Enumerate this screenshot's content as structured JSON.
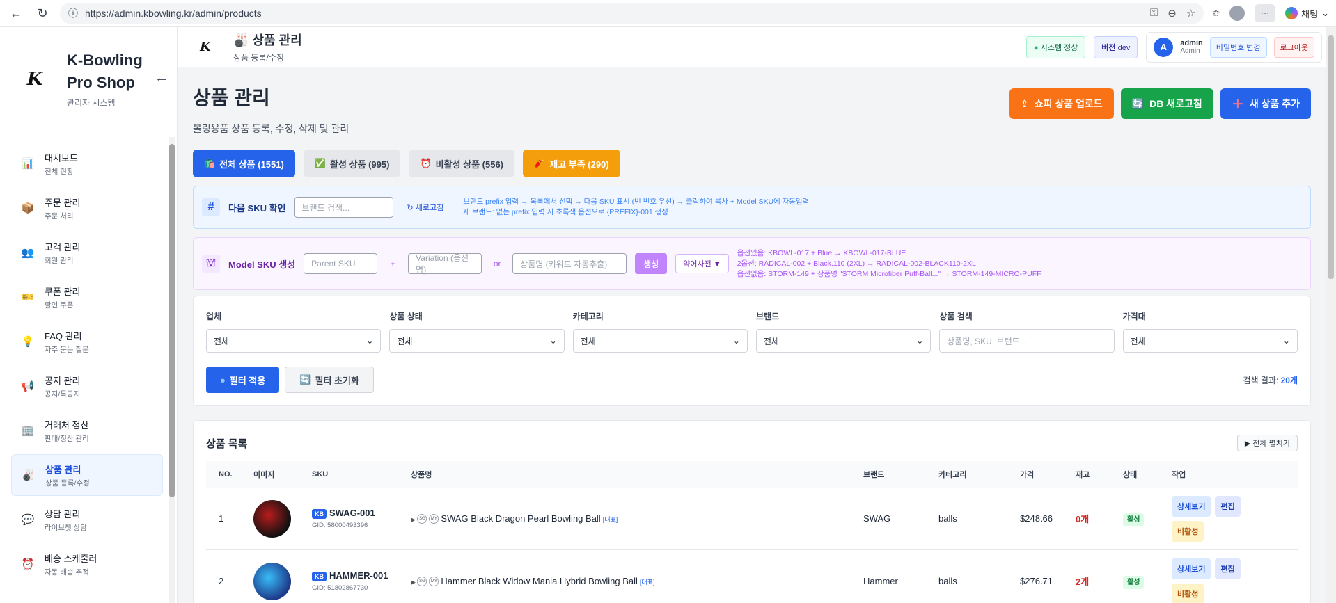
{
  "browser": {
    "url": "https://admin.kbowling.kr/admin/products",
    "chat_label": "채팅"
  },
  "sidebar": {
    "logo_text": "K",
    "title_line1": "K-Bowling",
    "title_line2": "Pro Shop",
    "subtitle": "관리자 시스템",
    "items": [
      {
        "title": "대시보드",
        "sub": "전체 현황",
        "icon": "📊"
      },
      {
        "title": "주문 관리",
        "sub": "주문 처리",
        "icon": "📦"
      },
      {
        "title": "고객 관리",
        "sub": "회원 관리",
        "icon": "👥"
      },
      {
        "title": "쿠폰 관리",
        "sub": "할인 쿠폰",
        "icon": "🎫"
      },
      {
        "title": "FAQ 관리",
        "sub": "자주 묻는 질문",
        "icon": "💡"
      },
      {
        "title": "공지 관리",
        "sub": "공지/특공지",
        "icon": "📢"
      },
      {
        "title": "거래처 정산",
        "sub": "판매/정산 관리",
        "icon": "🏢"
      },
      {
        "title": "상품 관리",
        "sub": "상품 등록/수정",
        "icon": "🎳"
      },
      {
        "title": "상담 관리",
        "sub": "라이브챗 상담",
        "icon": "💬"
      },
      {
        "title": "배송 스케줄러",
        "sub": "자동 배송 추적",
        "icon": "⏰"
      }
    ]
  },
  "topbar": {
    "title": "상품 관리",
    "subtitle": "상품 등록/수정",
    "system_status": "시스템 정상",
    "version_label": "버전",
    "version_value": "dev",
    "user_initial": "A",
    "user_name": "admin",
    "user_role": "Admin",
    "change_pw": "비밀번호 변경",
    "logout": "로그아웃"
  },
  "page": {
    "title": "상품 관리",
    "subtitle": "볼링용품 상품 등록, 수정, 삭제 및 관리",
    "btn_shopee": "쇼피 상품 업로드",
    "btn_db": "DB 새로고침",
    "btn_new": "새 상품 추가"
  },
  "tabs": {
    "all": "전체 상품 (1551)",
    "active": "활성 상품 (995)",
    "inactive": "비활성 상품 (556)",
    "low": "재고 부족 (290)"
  },
  "sku_panel": {
    "label": "다음 SKU 확인",
    "placeholder": "브랜드 검색...",
    "refresh": "새로고침",
    "hint1": "브랜드 prefix 입력 → 목록에서 선택 → 다음 SKU 표시 (빈 번호 우선) → 클릭하여 복사 + Model SKU에 자동입력",
    "hint2": "새 브랜드: 없는 prefix 입력 시 초록색 옵션으로 {PREFIX}-001 생성"
  },
  "model_panel": {
    "label": "Model SKU 생성",
    "parent_ph": "Parent SKU",
    "plus": "+",
    "variation_ph": "Variation (옵션명)",
    "or": "or",
    "name_ph": "상품명 (키워드 자동추출)",
    "gen": "생성",
    "dict": "약어사전 ▼",
    "hint1": "옵션있음: KBOWL-017 + Blue → KBOWL-017-BLUE",
    "hint2": "2옵션: RADICAL-002 + Black,110 (2XL) → RADICAL-002-BLACK110-2XL",
    "hint3": "옵션없음: STORM-149 + 상품명 \"STORM Microfiber Puff-Ball...\" → STORM-149-MICRO-PUFF"
  },
  "filters": {
    "labels": [
      "업체",
      "상품 상태",
      "카테고리",
      "브랜드",
      "상품 검색",
      "가격대"
    ],
    "values": [
      "전체",
      "전체",
      "전체",
      "전체",
      "",
      "전체"
    ],
    "search_ph": "상품명, SKU, 브랜드...",
    "apply": "필터 적용",
    "reset": "필터 초기화",
    "result_label": "검색 결과:",
    "result_count": "20개"
  },
  "list": {
    "title": "상품 목록",
    "expand": "▶ 전체 펼치기",
    "columns": [
      "NO.",
      "이미지",
      "SKU",
      "상품명",
      "브랜드",
      "카테고리",
      "가격",
      "재고",
      "상태",
      "작업"
    ],
    "rows": [
      {
        "no": "1",
        "kb": "KB",
        "sku": "SWAG-001",
        "gid": "GID: 58000493396",
        "name": "SWAG Black Dragon Pearl Bowling Ball",
        "rep": "[대표]",
        "brand": "SWAG",
        "category": "balls",
        "price": "$248.66",
        "stock": "0개",
        "status": "활성",
        "view": "상세보기",
        "edit": "편집",
        "deact": "비활성"
      },
      {
        "no": "2",
        "kb": "KB",
        "sku": "HAMMER-001",
        "gid": "GID: 51802867730",
        "name": "Hammer Black Widow Mania Hybrid Bowling Ball",
        "rep": "[대표]",
        "brand": "Hammer",
        "category": "balls",
        "price": "$276.71",
        "stock": "2개",
        "status": "활성",
        "view": "상세보기",
        "edit": "편집",
        "deact": "비활성"
      }
    ],
    "tag_sg": "SG",
    "tag_my": "MY"
  },
  "colors": {
    "primary": "#2563eb",
    "shopee": "#f97316",
    "db": "#16a34a",
    "warning": "#f59e0b"
  }
}
